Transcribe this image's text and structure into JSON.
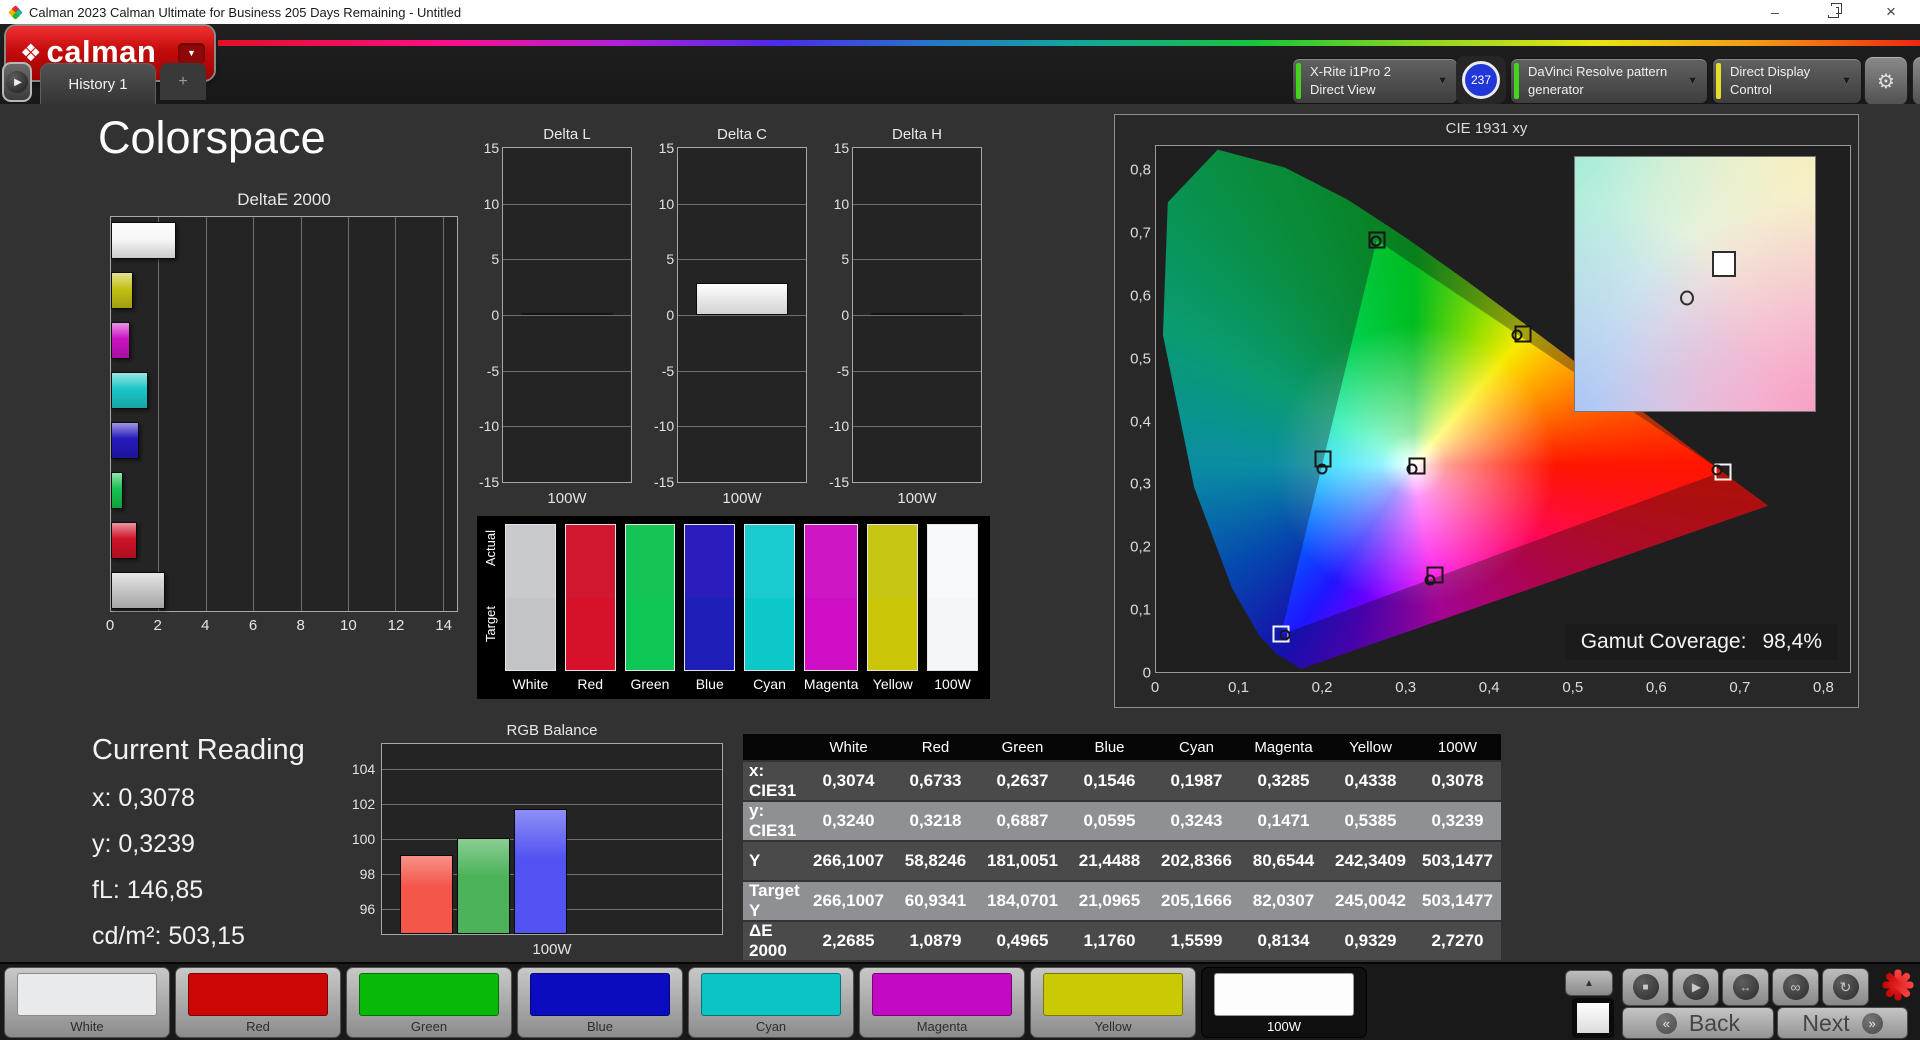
{
  "window": {
    "title": "Calman 2023 Calman Ultimate for Business 205 Days Remaining  - Untitled"
  },
  "header": {
    "logo_text": "calman",
    "active_tab": "History 1",
    "add_tab": "+",
    "meter_dropdown": {
      "line1": "X-Rite i1Pro 2",
      "line2": "Direct View",
      "accent": "#43d41d"
    },
    "reading_badge": "237",
    "pattern_dropdown": {
      "label": "DaVinci Resolve pattern generator",
      "accent": "#43d41d"
    },
    "display_dropdown": {
      "label": "Direct Display Control",
      "accent": "#e6df2a"
    }
  },
  "page_title": "Colorspace",
  "chart_data": [
    {
      "id": "deltae_2000",
      "type": "bar",
      "orientation": "horizontal",
      "title": "DeltaE 2000",
      "categories": [
        "100W",
        "Yellow",
        "Magenta",
        "Cyan",
        "Blue",
        "Green",
        "Red",
        "White"
      ],
      "values": [
        2.727,
        0.9329,
        0.8134,
        1.5599,
        1.176,
        0.4965,
        1.0879,
        2.2685
      ],
      "bar_colors": [
        "#f8f8f8",
        "#c3c013",
        "#cb12c2",
        "#1cc7c9",
        "#2519ba",
        "#15c14e",
        "#d01228",
        "#c9c9c9"
      ],
      "xlim": [
        0,
        14.6
      ],
      "xticks": [
        0,
        2,
        4,
        6,
        8,
        10,
        12,
        14
      ],
      "grid": true
    },
    {
      "id": "delta_l",
      "type": "bar",
      "title": "Delta L",
      "categories": [
        "100W"
      ],
      "values": [
        0
      ],
      "ylim": [
        -15,
        15
      ],
      "yticks": [
        15,
        10,
        5,
        0,
        -5,
        -10,
        -15
      ],
      "x_label": "100W"
    },
    {
      "id": "delta_c",
      "type": "bar",
      "title": "Delta C",
      "categories": [
        "100W"
      ],
      "values": [
        2.9
      ],
      "ylim": [
        -15,
        15
      ],
      "yticks": [
        15,
        10,
        5,
        0,
        -5,
        -10,
        -15
      ],
      "x_label": "100W"
    },
    {
      "id": "delta_h",
      "type": "bar",
      "title": "Delta H",
      "categories": [
        "100W"
      ],
      "values": [
        0
      ],
      "ylim": [
        -15,
        15
      ],
      "yticks": [
        15,
        10,
        5,
        0,
        -5,
        -10,
        -15
      ],
      "x_label": "100W"
    },
    {
      "id": "rgb_balance",
      "type": "bar",
      "title": "RGB Balance",
      "categories": [
        "Red",
        "Green",
        "Blue"
      ],
      "values": [
        99.1,
        100.05,
        101.7
      ],
      "bar_colors": [
        "#f4564a",
        "#4cb35a",
        "#5153f2"
      ],
      "ylim": [
        94.6,
        105.4
      ],
      "yticks": [
        104,
        102,
        100,
        98,
        96
      ],
      "x_label": "100W"
    },
    {
      "id": "cie_1931",
      "type": "scatter",
      "title": "CIE 1931 xy",
      "xlim": [
        0,
        0.833
      ],
      "ylim": [
        0,
        0.84
      ],
      "xtick_labels": [
        "0",
        "0,1",
        "0,2",
        "0,3",
        "0,4",
        "0,5",
        "0,6",
        "0,7",
        "0,8"
      ],
      "ytick_labels": [
        "0",
        "0,1",
        "0,2",
        "0,3",
        "0,4",
        "0,5",
        "0,6",
        "0,7",
        "0,8"
      ],
      "gamut_label": "Gamut Coverage:",
      "gamut_value": "98,4%",
      "gamut_triangle": [
        [
          0.68,
          0.32
        ],
        [
          0.265,
          0.69
        ],
        [
          0.15,
          0.06
        ]
      ],
      "points": [
        {
          "name": "white",
          "square": [
            0.313,
            0.329
          ],
          "circle": [
            0.3074,
            0.324
          ],
          "dark": true
        },
        {
          "name": "red",
          "square": [
            0.68,
            0.32
          ],
          "circle": [
            0.6733,
            0.3218
          ],
          "dark": false
        },
        {
          "name": "green",
          "square": [
            0.265,
            0.69
          ],
          "circle": [
            0.2637,
            0.6887
          ],
          "dark": true
        },
        {
          "name": "blue",
          "square": [
            0.15,
            0.06
          ],
          "circle": [
            0.1546,
            0.0595
          ],
          "dark": false
        },
        {
          "name": "cyan",
          "square": [
            0.2,
            0.34
          ],
          "circle": [
            0.1987,
            0.3243
          ],
          "dark": true
        },
        {
          "name": "magenta",
          "square": [
            0.335,
            0.155
          ],
          "circle": [
            0.3285,
            0.1471
          ],
          "dark": true
        },
        {
          "name": "yellow",
          "square": [
            0.44,
            0.54
          ],
          "circle": [
            0.4338,
            0.5385
          ],
          "dark": true
        }
      ],
      "inset": {
        "square": [
          0.62,
          0.42
        ],
        "circle": [
          0.465,
          0.555
        ]
      }
    }
  ],
  "swatch_strip": {
    "actual_label": "Actual",
    "target_label": "Target",
    "columns": [
      {
        "label": "White",
        "actual": "#c9cacd",
        "target": "#c3c5c8"
      },
      {
        "label": "Red",
        "actual": "#d11830",
        "target": "#d8112a"
      },
      {
        "label": "Green",
        "actual": "#14c455",
        "target": "#0ec653"
      },
      {
        "label": "Blue",
        "actual": "#2b1dbd",
        "target": "#1d1fb8"
      },
      {
        "label": "Cyan",
        "actual": "#19cbcd",
        "target": "#0cc9c9"
      },
      {
        "label": "Magenta",
        "actual": "#ce16c6",
        "target": "#d00fc4"
      },
      {
        "label": "Yellow",
        "actual": "#c8c615",
        "target": "#cbc708"
      },
      {
        "label": "100W",
        "actual": "#f8f9fb",
        "target": "#f5f6f8"
      }
    ]
  },
  "current_reading": {
    "title": "Current Reading",
    "lines": [
      {
        "label": "x:",
        "value": "0,3078"
      },
      {
        "label": "y:",
        "value": "0,3239"
      },
      {
        "label": "fL:",
        "value": "146,85"
      },
      {
        "label": "cd/m²:",
        "value": "503,15"
      }
    ]
  },
  "table": {
    "headers": [
      "",
      "White",
      "Red",
      "Green",
      "Blue",
      "Cyan",
      "Magenta",
      "Yellow",
      "100W"
    ],
    "rows": [
      {
        "label": "x: CIE31",
        "highlight": false,
        "values": [
          "0,3074",
          "0,6733",
          "0,2637",
          "0,1546",
          "0,1987",
          "0,3285",
          "0,4338",
          "0,3078"
        ]
      },
      {
        "label": "y: CIE31",
        "highlight": true,
        "values": [
          "0,3240",
          "0,3218",
          "0,6887",
          "0,0595",
          "0,3243",
          "0,1471",
          "0,5385",
          "0,3239"
        ]
      },
      {
        "label": "Y",
        "highlight": false,
        "values": [
          "266,1007",
          "58,8246",
          "181,0051",
          "21,4488",
          "202,8366",
          "80,6544",
          "242,3409",
          "503,1477"
        ]
      },
      {
        "label": "Target Y",
        "highlight": true,
        "values": [
          "266,1007",
          "60,9341",
          "184,0701",
          "21,0965",
          "205,1666",
          "82,0307",
          "245,0042",
          "503,1477"
        ]
      },
      {
        "label": "ΔE 2000",
        "highlight": false,
        "values": [
          "2,2685",
          "1,0879",
          "0,4965",
          "1,1760",
          "1,5599",
          "0,8134",
          "0,9329",
          "2,7270"
        ]
      }
    ]
  },
  "bottom_bar": {
    "patches": [
      {
        "label": "White",
        "color": "#e9eaec",
        "selected": false
      },
      {
        "label": "Red",
        "color": "#cc0505",
        "selected": false
      },
      {
        "label": "Green",
        "color": "#08b908",
        "selected": false
      },
      {
        "label": "Blue",
        "color": "#0b0bc0",
        "selected": false
      },
      {
        "label": "Cyan",
        "color": "#0cc4c4",
        "selected": false
      },
      {
        "label": "Magenta",
        "color": "#c409c4",
        "selected": false
      },
      {
        "label": "Yellow",
        "color": "#c9c905",
        "selected": false
      },
      {
        "label": "100W",
        "color": "#fdfdfd",
        "selected": true
      }
    ],
    "back_label": "Back",
    "next_label": "Next"
  },
  "icons": {
    "dropdown-caret": "▼",
    "play": "▶",
    "up": "▲",
    "back": "«",
    "next": "»",
    "stop": "■",
    "step": "↔",
    "continuous": "∞",
    "refresh": "↻",
    "gear": "⚙",
    "logo-mark": "❖",
    "minimize": "–",
    "close": "×",
    "left": "◀",
    "add": "+"
  }
}
